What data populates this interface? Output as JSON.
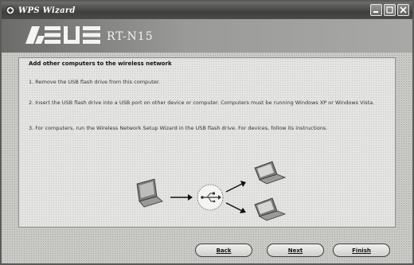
{
  "window": {
    "title": "WPS Wizard"
  },
  "banner": {
    "brand": "ASUS",
    "subtitle": "RT-N15"
  },
  "content": {
    "heading": "Add other computers to the wireless network",
    "steps": [
      "1. Remove the USB flash drive from this computer.",
      "2. Insert the USB flash drive into a USB port on other device or computer. Computers must be running Windows XP or Windows Vista.",
      "3. For computers, run the Wireless Network Setup Wizard in the USB flash drive. For devices, follow its instructions."
    ]
  },
  "buttons": {
    "back": "Back",
    "next": "Next",
    "finish": "Finish"
  },
  "icons": {
    "title_logo": "wps-logo-icon",
    "minimize": "minimize-icon",
    "maximize": "maximize-icon",
    "close": "close-icon",
    "diagram": [
      "laptop-icon",
      "arrow-icon",
      "usb-icon",
      "laptop-icon",
      "laptop-icon"
    ]
  },
  "colors": {
    "titlebar": "#4a4a48",
    "banner": "#9a9a98",
    "panel": "#e4e4e2"
  }
}
